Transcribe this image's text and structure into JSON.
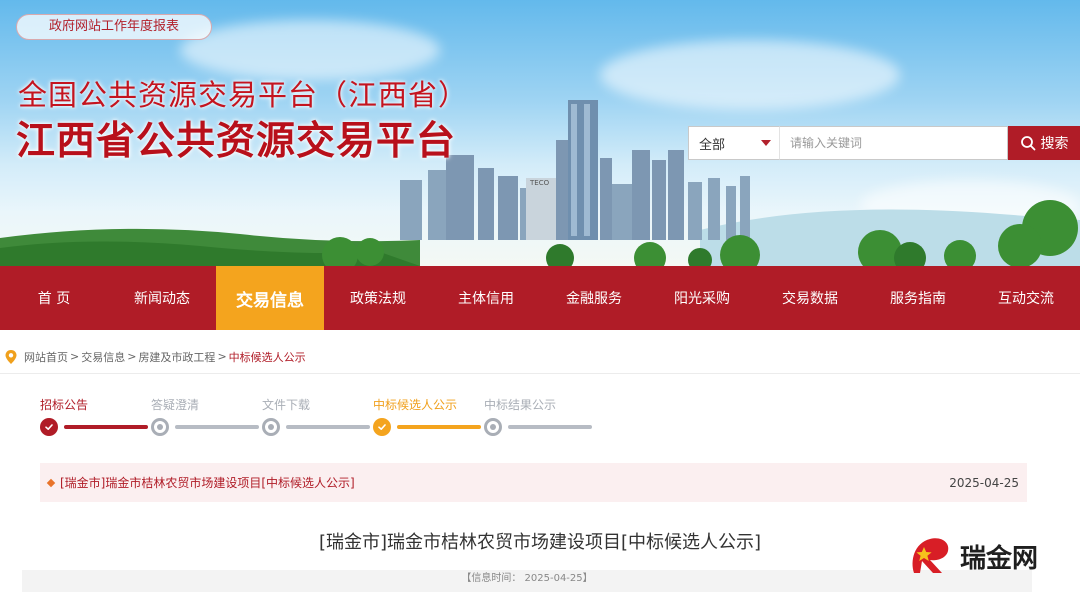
{
  "header": {
    "report_button": "政府网站工作年度报表",
    "title_line1": "全国公共资源交易平台（江西省）",
    "title_line2": "江西省公共资源交易平台"
  },
  "search": {
    "category": "全部",
    "placeholder": "请输入关键词",
    "value": "",
    "button": "搜索"
  },
  "nav": {
    "items": [
      {
        "label": "首 页"
      },
      {
        "label": "新闻动态"
      },
      {
        "label": "交易信息"
      },
      {
        "label": "政策法规"
      },
      {
        "label": "主体信用"
      },
      {
        "label": "金融服务"
      },
      {
        "label": "阳光采购"
      },
      {
        "label": "交易数据"
      },
      {
        "label": "服务指南"
      },
      {
        "label": "互动交流"
      }
    ],
    "active_index": 2
  },
  "breadcrumb": {
    "items": [
      "网站首页",
      "交易信息",
      "房建及市政工程",
      "中标候选人公示"
    ]
  },
  "steps": [
    {
      "label": "招标公告",
      "state": "done"
    },
    {
      "label": "答疑澄清",
      "state": "pending"
    },
    {
      "label": "文件下载",
      "state": "pending"
    },
    {
      "label": "中标候选人公示",
      "state": "current"
    },
    {
      "label": "中标结果公示",
      "state": "pending"
    }
  ],
  "notice": {
    "title": "[瑞金市]瑞金市桔林农贸市场建设项目[中标候选人公示]",
    "date": "2025-04-25"
  },
  "article": {
    "title": "[瑞金市]瑞金市桔林农贸市场建设项目[中标候选人公示]",
    "info": "【信息时间：  2025-04-25】"
  },
  "watermark": {
    "text": "瑞金网"
  },
  "colors": {
    "primary": "#b01c27",
    "accent": "#f4a41e",
    "muted": "#a9aeb6"
  }
}
